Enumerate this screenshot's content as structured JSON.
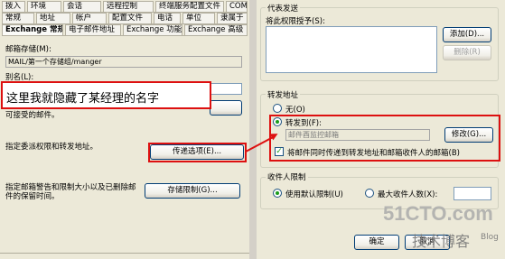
{
  "tabs_row1": [
    "拨入",
    "环境",
    "会话",
    "远程控制",
    "终端服务配置文件",
    "COM+"
  ],
  "tabs_row2": [
    "常规",
    "地址",
    "帐户",
    "配置文件",
    "电话",
    "单位",
    "隶属于"
  ],
  "tabs_row3": [
    "Exchange 常规",
    "电子邮件地址",
    "Exchange 功能",
    "Exchange 高级"
  ],
  "mailbox_store_label": "邮箱存储(M):",
  "mailbox_store_value": "MAIL/第一个存储组/manger",
  "alias_label": "别名(L):",
  "annotation_text": "这里我就隐藏了某经理的名字",
  "delivery_restrictions_text": "可接受的邮件。",
  "delivery_options_text": "指定委派权限和转发地址。",
  "delivery_options_button": "传递选项(E)...",
  "storage_limits_text": "指定邮箱警告和限制大小以及已删除邮件的保留时间。",
  "storage_limits_button": "存储限制(G)...",
  "send_on_behalf_title": "代表发送",
  "grant_permission_label": "将此权限授予(S):",
  "add_button": "添加(D)...",
  "remove_button": "删除(R)",
  "forwarding_title": "转发地址",
  "none_option": "无(O)",
  "forward_to_option": "转发到(F):",
  "forward_to_value": "邮件酉监控邮箱",
  "modify_button": "修改(G)...",
  "deliver_both_label": "将邮件同时传递到转发地址和邮箱收件人的邮箱(B)",
  "recipient_limits_title": "收件人限制",
  "use_default_option": "使用默认限制(U)",
  "max_recipients_option": "最大收件人数(X):",
  "ok_button": "确定",
  "cancel_button": "取消",
  "watermark_brand": "51CTO.com",
  "watermark_sub": "技术博客",
  "watermark_blog": "Blog"
}
